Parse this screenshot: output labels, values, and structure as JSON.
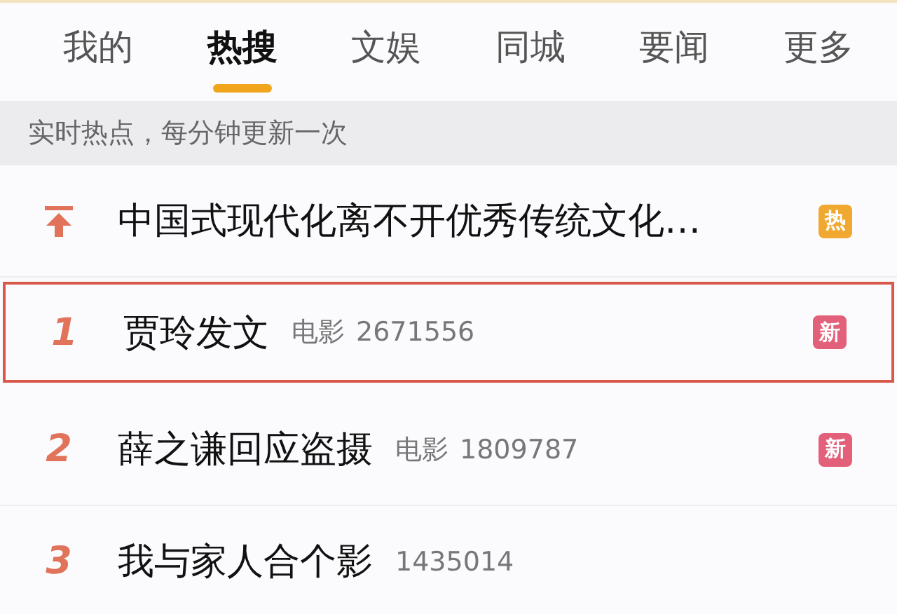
{
  "tabs": [
    {
      "label": "我的",
      "selected": false
    },
    {
      "label": "热搜",
      "selected": true
    },
    {
      "label": "文娱",
      "selected": false
    },
    {
      "label": "同城",
      "selected": false
    },
    {
      "label": "要闻",
      "selected": false
    },
    {
      "label": "更多",
      "selected": false
    }
  ],
  "banner": "实时热点，每分钟更新一次",
  "rows": [
    {
      "kind": "pin",
      "title": "中国式现代化离不开优秀传统文化…",
      "badge": "热",
      "color": "#f0a830",
      "highlighted": false
    },
    {
      "kind": "number",
      "rank": "1",
      "title": "贾玲发文",
      "category": "电影",
      "count": "2671556",
      "badge": "新",
      "color": "#e2607a",
      "highlighted": true
    },
    {
      "kind": "number",
      "rank": "2",
      "title": "薛之谦回应盗摄",
      "category": "电影",
      "count": "1809787",
      "badge": "新",
      "color": "#e2607a",
      "highlighted": false
    },
    {
      "kind": "number",
      "rank": "3",
      "title": "我与家人合个影",
      "count": "1435014",
      "highlighted": false
    }
  ]
}
